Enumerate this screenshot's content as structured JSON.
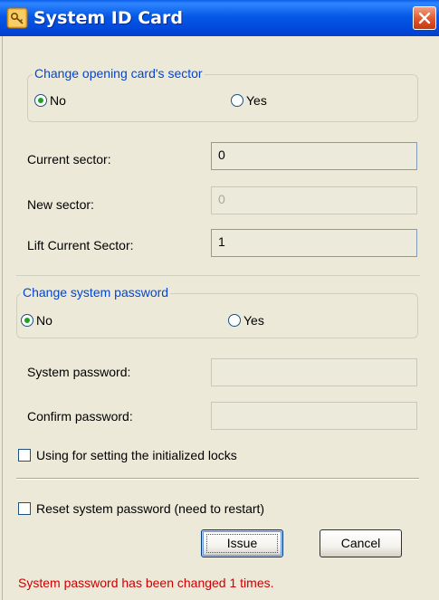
{
  "window": {
    "title": "System ID Card",
    "app_icon": "key-card-icon",
    "close_icon": "close-icon"
  },
  "sector_group": {
    "legend": "Change opening card's sector",
    "option_no": "No",
    "option_yes": "Yes",
    "selected": "No"
  },
  "sector_fields": {
    "current_sector_label": "Current sector:",
    "current_sector_value": "0",
    "new_sector_label": "New sector:",
    "new_sector_value": "0",
    "lift_current_sector_label": "Lift Current Sector:",
    "lift_current_sector_value": "1"
  },
  "password_group": {
    "legend": "Change system password",
    "option_no": "No",
    "option_yes": "Yes",
    "selected": "No"
  },
  "password_fields": {
    "system_password_label": "System password:",
    "system_password_value": "",
    "confirm_password_label": "Confirm password:",
    "confirm_password_value": ""
  },
  "options": {
    "init_locks_label": "Using for setting the initialized locks",
    "init_locks_checked": false,
    "reset_password_label": "Reset system password (need to restart)",
    "reset_password_checked": false
  },
  "buttons": {
    "issue_label": "Issue",
    "cancel_label": "Cancel"
  },
  "status": {
    "message": "System password has been changed 1 times.",
    "color": "#cc0000"
  },
  "colors": {
    "title_bar": "#0658e6",
    "accent_legend": "#0046d5",
    "dialog_bg": "#ece9d8",
    "radio_dot": "#21a121"
  }
}
